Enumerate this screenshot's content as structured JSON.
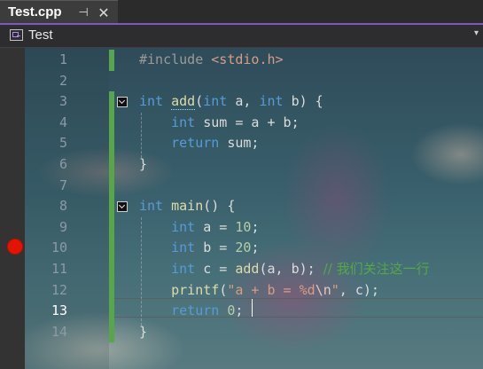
{
  "tab": {
    "title": "Test.cpp",
    "pin_glyph": "⊣",
    "close_glyph": "✕"
  },
  "navbar": {
    "project": "Test",
    "dropdown_glyph": "▾"
  },
  "editor": {
    "current_line": 13,
    "breakpoint_line": 10,
    "line_numbers": [
      "1",
      "2",
      "3",
      "4",
      "5",
      "6",
      "7",
      "8",
      "9",
      "10",
      "11",
      "12",
      "13",
      "14"
    ],
    "colors": {
      "keyword": "#569cd6",
      "function": "#dcdcaa",
      "number": "#b5cea8",
      "string": "#d69d85",
      "comment": "#57a64a",
      "breakpoint": "#e51400",
      "change_bar": "#57a64a",
      "tab_accent": "#7e57c2"
    },
    "lines": [
      [
        [
          "pre",
          "#include "
        ],
        [
          "inc",
          "<stdio.h>"
        ]
      ],
      [],
      [
        [
          "kw",
          "int"
        ],
        [
          "txt",
          " "
        ],
        [
          "fn",
          "add"
        ],
        [
          "txt",
          "("
        ],
        [
          "kw",
          "int"
        ],
        [
          "txt",
          " a, "
        ],
        [
          "kw",
          "int"
        ],
        [
          "txt",
          " b) {"
        ]
      ],
      [
        [
          "txt",
          "    "
        ],
        [
          "kw",
          "int"
        ],
        [
          "txt",
          " sum = a + b;"
        ]
      ],
      [
        [
          "txt",
          "    "
        ],
        [
          "kw",
          "return"
        ],
        [
          "txt",
          " sum;"
        ]
      ],
      [
        [
          "txt",
          "}"
        ]
      ],
      [],
      [
        [
          "kw",
          "int"
        ],
        [
          "txt",
          " "
        ],
        [
          "fn",
          "main"
        ],
        [
          "txt",
          "() {"
        ]
      ],
      [
        [
          "txt",
          "    "
        ],
        [
          "kw",
          "int"
        ],
        [
          "txt",
          " a = "
        ],
        [
          "num",
          "10"
        ],
        [
          "txt",
          ";"
        ]
      ],
      [
        [
          "txt",
          "    "
        ],
        [
          "kw",
          "int"
        ],
        [
          "txt",
          " b = "
        ],
        [
          "num",
          "20"
        ],
        [
          "txt",
          ";"
        ]
      ],
      [
        [
          "txt",
          "    "
        ],
        [
          "kw",
          "int"
        ],
        [
          "txt",
          " c = "
        ],
        [
          "fn",
          "add"
        ],
        [
          "txt",
          "(a, b); "
        ],
        [
          "cm",
          "// 我们关注这一行"
        ]
      ],
      [
        [
          "txt",
          "    "
        ],
        [
          "fn",
          "printf"
        ],
        [
          "txt",
          "("
        ],
        [
          "str",
          "\"a + b = %d"
        ],
        [
          "esc",
          "\\n"
        ],
        [
          "str",
          "\""
        ],
        [
          "txt",
          ", c);"
        ]
      ],
      [
        [
          "txt",
          "    "
        ],
        [
          "kw",
          "return"
        ],
        [
          "txt",
          " "
        ],
        [
          "num",
          "0"
        ],
        [
          "txt",
          ";"
        ]
      ],
      [
        [
          "txt",
          "}"
        ]
      ]
    ]
  }
}
